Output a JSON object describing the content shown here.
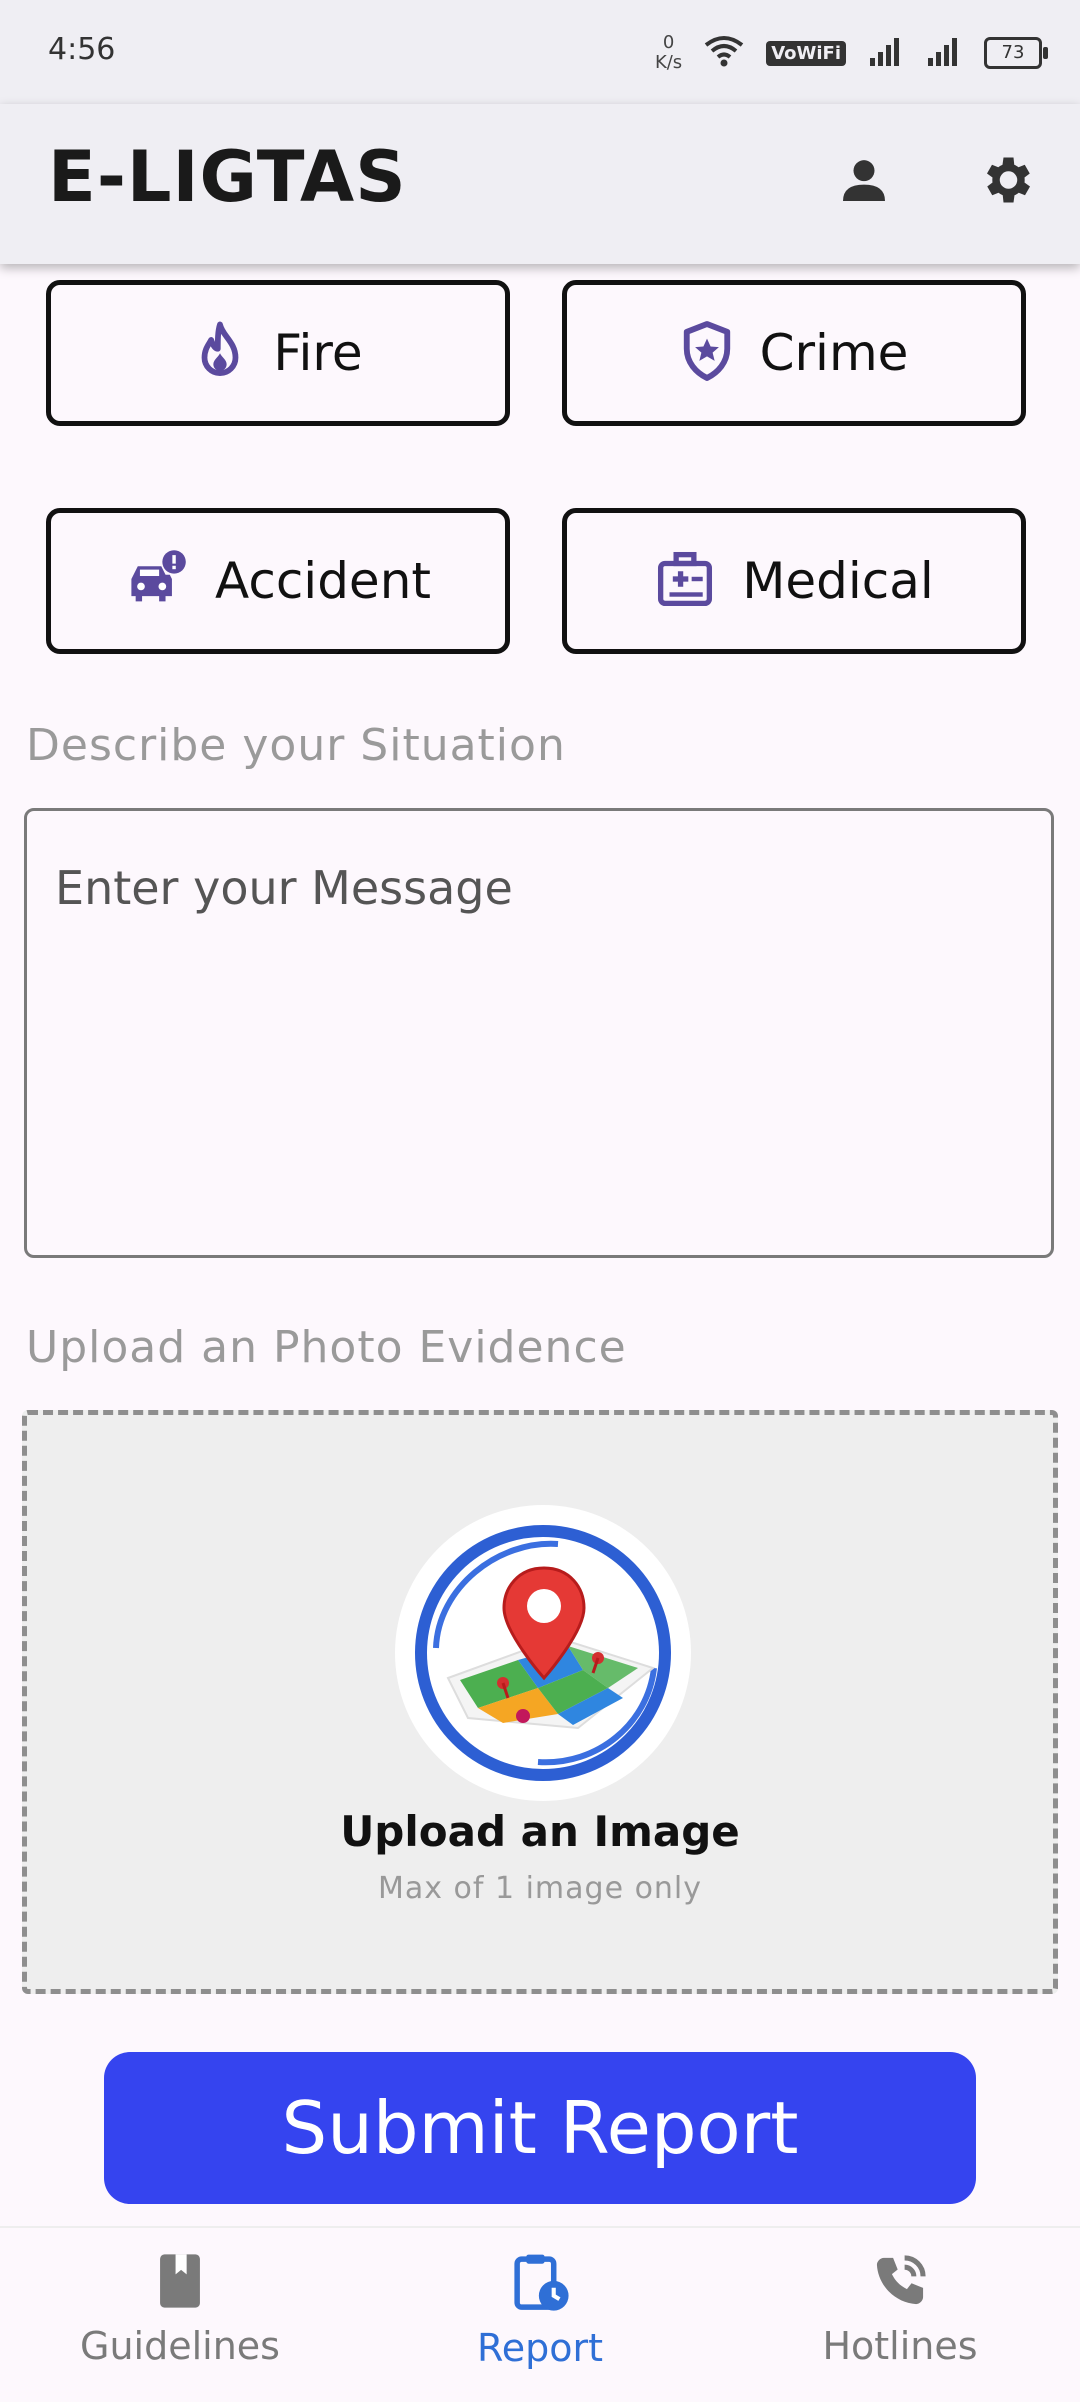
{
  "status_bar": {
    "time": "4:56",
    "net_speed_value": "0",
    "net_speed_unit": "K/s",
    "vowifi": "VoWiFi",
    "battery": "73"
  },
  "app_bar": {
    "title": "E-LIGTAS",
    "icons": [
      "person-icon",
      "gear-icon"
    ]
  },
  "categories": [
    {
      "label": "Fire",
      "icon": "fire-icon"
    },
    {
      "label": "Crime",
      "icon": "shield-star-icon"
    },
    {
      "label": "Accident",
      "icon": "car-crash-icon"
    },
    {
      "label": "Medical",
      "icon": "medical-kit-icon"
    }
  ],
  "description": {
    "label": "Describe your Situation",
    "placeholder": "Enter your Message",
    "value": ""
  },
  "photo": {
    "label": "Upload an Photo Evidence",
    "title": "Upload an Image",
    "subtitle": "Max of 1 image only"
  },
  "submit": {
    "label": "Submit Report"
  },
  "bottom_nav": {
    "items": [
      {
        "label": "Guidelines",
        "icon": "book-icon",
        "active": false
      },
      {
        "label": "Report",
        "icon": "clipboard-clock-icon",
        "active": true
      },
      {
        "label": "Hotlines",
        "icon": "phone-ring-icon",
        "active": false
      }
    ]
  },
  "colors": {
    "accent": "#3544ef",
    "icon_purple": "#5b4a9e",
    "nav_inactive": "#7a7a7a",
    "nav_active": "#2f6fd6"
  }
}
